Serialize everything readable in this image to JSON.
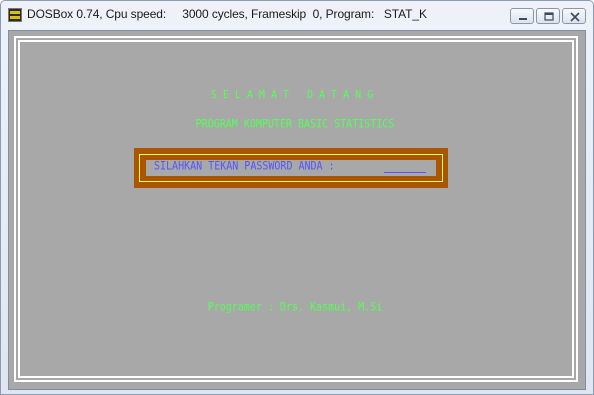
{
  "window": {
    "title": "DOSBox 0.74, Cpu speed:     3000 cycles, Frameskip  0, Program:   STAT_K",
    "icon": "dosbox-icon",
    "controls": [
      "minimize-icon",
      "maximize-icon",
      "close-icon"
    ]
  },
  "screen": {
    "welcome": "SELAMAT DATANG",
    "subtitle": "PROGRAM KOMPUTER BASIC STATISTICS",
    "password_prompt": "SILAHKAN TEKAN PASSWORD ANDA : ",
    "footer": "Programer : Drs. Kasmui, M.Si"
  },
  "colors": {
    "background": "#a8a8a8",
    "green_text": "#55ff55",
    "prompt_text": "#5555ff",
    "box_fill": "#aa5500",
    "box_border": "#ffff55"
  }
}
